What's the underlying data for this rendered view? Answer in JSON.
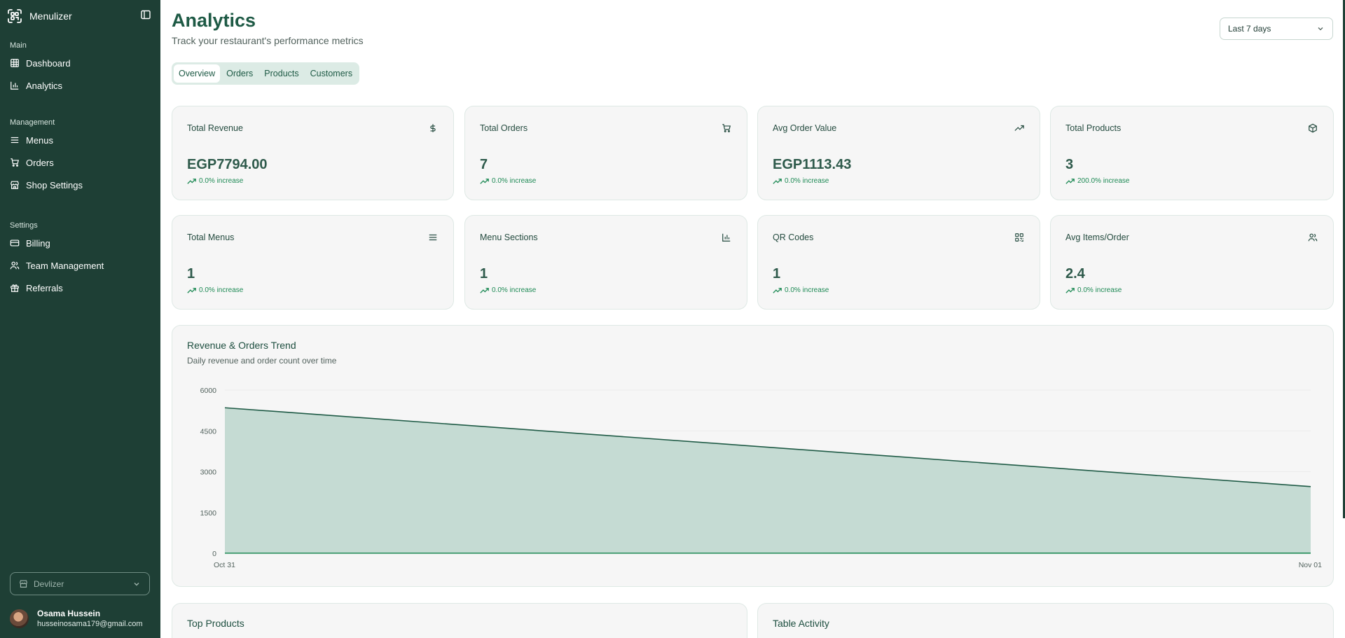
{
  "app": {
    "name": "Menulizer"
  },
  "sidebar": {
    "groups": [
      {
        "label": "Main",
        "items": [
          {
            "label": "Dashboard",
            "icon": "grid-icon"
          },
          {
            "label": "Analytics",
            "icon": "bar-chart-icon"
          }
        ]
      },
      {
        "label": "Management",
        "items": [
          {
            "label": "Menus",
            "icon": "menu-lines-icon"
          },
          {
            "label": "Orders",
            "icon": "cart-icon"
          },
          {
            "label": "Shop Settings",
            "icon": "store-icon"
          }
        ]
      },
      {
        "label": "Settings",
        "items": [
          {
            "label": "Billing",
            "icon": "credit-card-icon"
          },
          {
            "label": "Team Management",
            "icon": "users-icon"
          },
          {
            "label": "Referrals",
            "icon": "gift-icon"
          }
        ]
      }
    ],
    "workspace": "Devlizer",
    "user": {
      "name": "Osama Hussein",
      "email": "husseinosama179@gmail.com"
    }
  },
  "header": {
    "title": "Analytics",
    "subtitle": "Track your restaurant's performance metrics",
    "range": "Last 7 days"
  },
  "tabs": [
    "Overview",
    "Orders",
    "Products",
    "Customers"
  ],
  "stats": [
    {
      "label": "Total Revenue",
      "value": "EGP7794.00",
      "change": "0.0% increase",
      "icon": "dollar-icon"
    },
    {
      "label": "Total Orders",
      "value": "7",
      "change": "0.0% increase",
      "icon": "cart-icon"
    },
    {
      "label": "Avg Order Value",
      "value": "EGP1113.43",
      "change": "0.0% increase",
      "icon": "trending-up-icon"
    },
    {
      "label": "Total Products",
      "value": "3",
      "change": "200.0% increase",
      "icon": "box-icon"
    },
    {
      "label": "Total Menus",
      "value": "1",
      "change": "0.0% increase",
      "icon": "menu-lines-icon"
    },
    {
      "label": "Menu Sections",
      "value": "1",
      "change": "0.0% increase",
      "icon": "bar-chart-icon"
    },
    {
      "label": "QR Codes",
      "value": "1",
      "change": "0.0% increase",
      "icon": "qr-code-icon"
    },
    {
      "label": "Avg Items/Order",
      "value": "2.4",
      "change": "0.0% increase",
      "icon": "users-icon"
    }
  ],
  "trend": {
    "title": "Revenue & Orders Trend",
    "subtitle": "Daily revenue and order count over time"
  },
  "chart_data": {
    "type": "area",
    "x": [
      "Oct 31",
      "Nov 01"
    ],
    "series": [
      {
        "values": [
          5350,
          2450
        ],
        "color": "#1e5a45",
        "fill": "#c5dbd3"
      },
      {
        "values": [
          3,
          4
        ],
        "color": "#1e8a55"
      }
    ],
    "yticks": [
      0,
      1500,
      3000,
      4500,
      6000
    ],
    "ylim": [
      0,
      6000
    ],
    "grid": true
  },
  "sections": {
    "top_products": "Top Products",
    "table_activity": "Table Activity"
  }
}
